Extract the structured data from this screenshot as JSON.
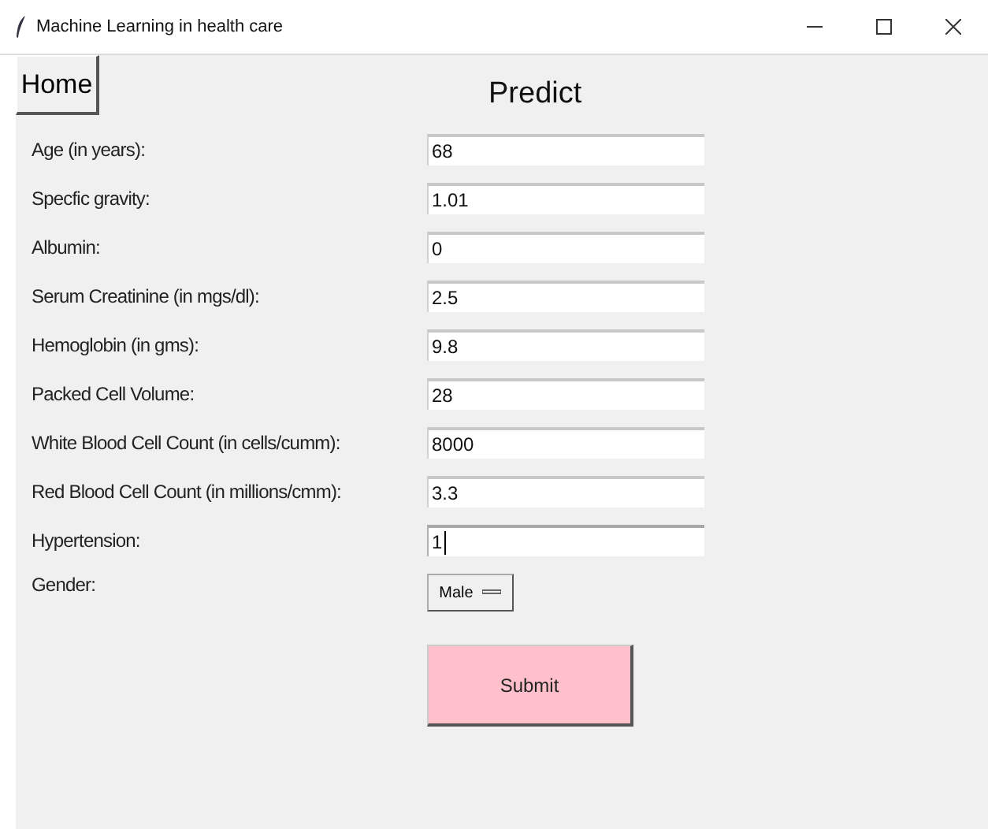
{
  "window": {
    "title": "Machine Learning in health care"
  },
  "home_button": "Home",
  "heading": "Predict",
  "fields": [
    {
      "label": "Age (in years):",
      "value": "68",
      "focused": false
    },
    {
      "label": "Specfic gravity:",
      "value": "1.01",
      "focused": false
    },
    {
      "label": "Albumin:",
      "value": "0",
      "focused": false
    },
    {
      "label": "Serum Creatinine (in mgs/dl):",
      "value": "2.5",
      "focused": false
    },
    {
      "label": "Hemoglobin (in gms):",
      "value": "9.8",
      "focused": false
    },
    {
      "label": "Packed Cell Volume:",
      "value": "28",
      "focused": false
    },
    {
      "label": "White Blood Cell Count (in cells/cumm):",
      "value": "8000",
      "focused": false
    },
    {
      "label": "Red Blood Cell Count (in millions/cmm):",
      "value": "3.3",
      "focused": false
    },
    {
      "label": "Hypertension:",
      "value": "1",
      "focused": true
    }
  ],
  "gender": {
    "label": "Gender:",
    "value": "Male"
  },
  "submit_button": "Submit"
}
